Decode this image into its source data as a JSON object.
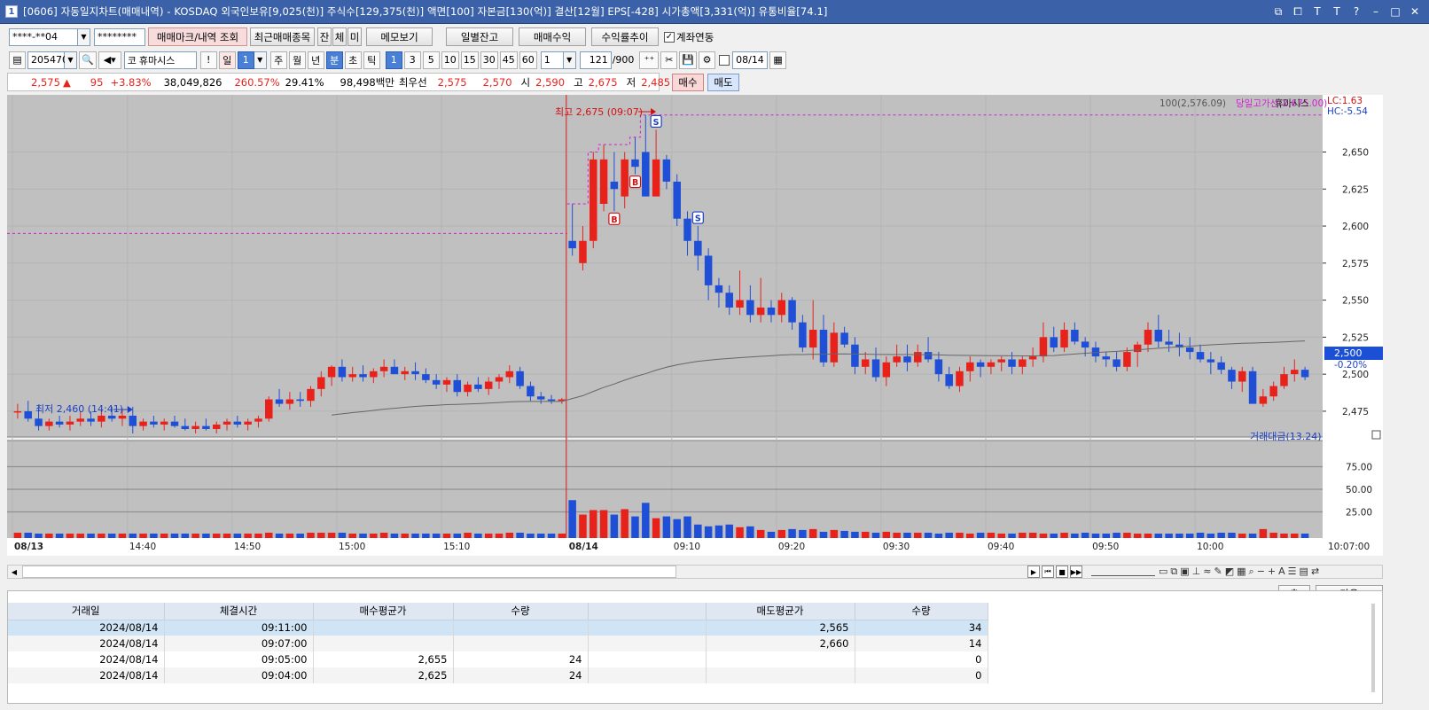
{
  "window": {
    "title": "[0606] 자동일지차트(매매내역) - KOSDAQ 외국인보유[9,025(천)] 주식수[129,375(천)] 액면[100] 자본금[130(억)] 결산[12월] EPS[-428] 시가총액[3,331(억)] 유통비율[74.1]",
    "icon_label": "1",
    "ctrls": [
      "⧉",
      "⧠",
      "T",
      "T",
      "?",
      "–",
      "□",
      "✕"
    ]
  },
  "toolbar1": {
    "account": "****-**04",
    "password": "********",
    "btn_mark": "매매마크/내역 조회",
    "btn_recent": "최근매매종목",
    "btn_jan": "잔",
    "btn_che": "체",
    "btn_mi": "미",
    "btn_memo": "메모보기",
    "btn_daily": "일별잔고",
    "btn_profit": "매매수익",
    "btn_rate": "수익률추이",
    "chk_link": "계좌연동",
    "chk_link_checked": "✓"
  },
  "toolbar2": {
    "code": "205470",
    "market": "코",
    "name": "휴마시스",
    "btn_warn": "!",
    "periods": [
      "일",
      "1",
      "주",
      "월",
      "년",
      "분",
      "초",
      "틱"
    ],
    "intervals": [
      "1",
      "3",
      "5",
      "10",
      "15",
      "30",
      "45",
      "60"
    ],
    "unit": "1",
    "count": "121",
    "count_total": "/900",
    "date": "08/14"
  },
  "pricebar": {
    "price": "2,575",
    "arrow": "▲",
    "change": "95",
    "change_pct": "+3.83%",
    "volume": "38,049,826",
    "vol_ratio": "260.57%",
    "turnover": "29.41%",
    "amount": "98,498백만",
    "best_label": "최우선",
    "ask": "2,575",
    "bid": "2,570",
    "open_label": "시",
    "open": "2,590",
    "high_label": "고",
    "high": "2,675",
    "low_label": "저",
    "low": "2,485",
    "buy_btn": "매수",
    "sell_btn": "매도"
  },
  "chart_labels": {
    "ma_label": "100(2,576.09)",
    "highline_label": "당일고가선(2,675.00)",
    "stock_label": "휴마시스",
    "lc": "LC:1.63",
    "hc": "HC:-5.54",
    "high_note": "최고 2,675 (09:07)",
    "low_note": "최저 2,460 (14:41)",
    "cur_price": "2,500",
    "cur_pct": "-0.20%",
    "vol_title": "거래대금(13.24)"
  },
  "chart_data": {
    "type": "candlestick",
    "y_ticks": [
      "2,650",
      "2,625",
      "2,600",
      "2,575",
      "2,550",
      "2,525",
      "2,500",
      "2,475"
    ],
    "ylim": [
      2460,
      2685
    ],
    "vol_ticks": [
      "75.00",
      "50.00",
      "25.00"
    ],
    "vol_lim": [
      0,
      100
    ],
    "x_labels": [
      "08/13",
      "14:40",
      "14:50",
      "15:00",
      "15:10",
      "08/14",
      "09:10",
      "09:20",
      "09:30",
      "09:40",
      "09:50",
      "10:00",
      "10:07:00"
    ],
    "x_label_idx": [
      0,
      11,
      21,
      31,
      41,
      53,
      63,
      73,
      83,
      93,
      103,
      113
    ],
    "session_split_idx": 53,
    "high_mark_idx": 61,
    "low_mark_idx": 11,
    "prev_high": 2595,
    "day_high": 2675,
    "candles": [
      [
        2475,
        2480,
        2470,
        2475
      ],
      [
        2475,
        2482,
        2468,
        2470
      ],
      [
        2470,
        2478,
        2462,
        2465
      ],
      [
        2465,
        2470,
        2462,
        2468
      ],
      [
        2468,
        2472,
        2464,
        2466
      ],
      [
        2466,
        2472,
        2462,
        2468
      ],
      [
        2468,
        2475,
        2465,
        2470
      ],
      [
        2470,
        2475,
        2465,
        2468
      ],
      [
        2468,
        2476,
        2464,
        2472
      ],
      [
        2472,
        2478,
        2468,
        2470
      ],
      [
        2470,
        2476,
        2465,
        2472
      ],
      [
        2472,
        2478,
        2460,
        2465
      ],
      [
        2465,
        2470,
        2462,
        2468
      ],
      [
        2468,
        2472,
        2464,
        2466
      ],
      [
        2466,
        2470,
        2462,
        2468
      ],
      [
        2468,
        2472,
        2464,
        2465
      ],
      [
        2465,
        2470,
        2462,
        2463
      ],
      [
        2463,
        2468,
        2460,
        2465
      ],
      [
        2465,
        2470,
        2462,
        2463
      ],
      [
        2463,
        2468,
        2460,
        2466
      ],
      [
        2466,
        2470,
        2462,
        2468
      ],
      [
        2468,
        2472,
        2464,
        2466
      ],
      [
        2466,
        2470,
        2462,
        2468
      ],
      [
        2468,
        2472,
        2464,
        2470
      ],
      [
        2470,
        2485,
        2468,
        2483
      ],
      [
        2483,
        2490,
        2478,
        2480
      ],
      [
        2480,
        2488,
        2476,
        2483
      ],
      [
        2483,
        2488,
        2478,
        2482
      ],
      [
        2482,
        2492,
        2478,
        2490
      ],
      [
        2490,
        2502,
        2485,
        2498
      ],
      [
        2498,
        2506,
        2492,
        2505
      ],
      [
        2505,
        2510,
        2495,
        2498
      ],
      [
        2498,
        2505,
        2495,
        2500
      ],
      [
        2500,
        2506,
        2495,
        2498
      ],
      [
        2498,
        2504,
        2494,
        2502
      ],
      [
        2502,
        2510,
        2498,
        2505
      ],
      [
        2505,
        2510,
        2500,
        2500
      ],
      [
        2500,
        2505,
        2496,
        2502
      ],
      [
        2502,
        2508,
        2496,
        2500
      ],
      [
        2500,
        2504,
        2494,
        2496
      ],
      [
        2496,
        2500,
        2490,
        2493
      ],
      [
        2493,
        2498,
        2488,
        2496
      ],
      [
        2496,
        2500,
        2485,
        2488
      ],
      [
        2488,
        2495,
        2485,
        2493
      ],
      [
        2493,
        2498,
        2488,
        2490
      ],
      [
        2490,
        2498,
        2486,
        2495
      ],
      [
        2495,
        2500,
        2490,
        2498
      ],
      [
        2498,
        2506,
        2494,
        2502
      ],
      [
        2502,
        2505,
        2490,
        2492
      ],
      [
        2492,
        2495,
        2482,
        2485
      ],
      [
        2485,
        2488,
        2480,
        2483
      ],
      [
        2483,
        2486,
        2480,
        2482
      ],
      [
        2482,
        2484,
        2480,
        2483
      ],
      [
        2590,
        2615,
        2580,
        2585
      ],
      [
        2575,
        2600,
        2570,
        2590
      ],
      [
        2590,
        2650,
        2585,
        2645
      ],
      [
        2615,
        2655,
        2610,
        2645
      ],
      [
        2630,
        2650,
        2610,
        2625
      ],
      [
        2620,
        2650,
        2612,
        2645
      ],
      [
        2645,
        2660,
        2635,
        2640
      ],
      [
        2650,
        2675,
        2620,
        2620
      ],
      [
        2620,
        2665,
        2620,
        2645
      ],
      [
        2645,
        2648,
        2625,
        2630
      ],
      [
        2630,
        2635,
        2600,
        2605
      ],
      [
        2605,
        2610,
        2580,
        2590
      ],
      [
        2590,
        2600,
        2570,
        2580
      ],
      [
        2580,
        2585,
        2550,
        2560
      ],
      [
        2560,
        2565,
        2545,
        2555
      ],
      [
        2555,
        2560,
        2540,
        2545
      ],
      [
        2545,
        2570,
        2540,
        2550
      ],
      [
        2550,
        2560,
        2535,
        2540
      ],
      [
        2540,
        2565,
        2535,
        2545
      ],
      [
        2545,
        2550,
        2535,
        2540
      ],
      [
        2540,
        2555,
        2535,
        2550
      ],
      [
        2550,
        2552,
        2530,
        2535
      ],
      [
        2535,
        2540,
        2515,
        2518
      ],
      [
        2518,
        2550,
        2510,
        2530
      ],
      [
        2530,
        2540,
        2505,
        2508
      ],
      [
        2508,
        2535,
        2505,
        2528
      ],
      [
        2528,
        2532,
        2518,
        2520
      ],
      [
        2520,
        2525,
        2500,
        2505
      ],
      [
        2505,
        2515,
        2500,
        2510
      ],
      [
        2510,
        2518,
        2495,
        2498
      ],
      [
        2498,
        2512,
        2492,
        2508
      ],
      [
        2508,
        2520,
        2505,
        2512
      ],
      [
        2512,
        2520,
        2502,
        2508
      ],
      [
        2508,
        2520,
        2505,
        2515
      ],
      [
        2515,
        2525,
        2508,
        2510
      ],
      [
        2510,
        2515,
        2495,
        2500
      ],
      [
        2500,
        2505,
        2490,
        2492
      ],
      [
        2492,
        2505,
        2488,
        2502
      ],
      [
        2502,
        2512,
        2495,
        2508
      ],
      [
        2508,
        2510,
        2498,
        2505
      ],
      [
        2505,
        2510,
        2500,
        2508
      ],
      [
        2508,
        2512,
        2502,
        2510
      ],
      [
        2510,
        2515,
        2500,
        2505
      ],
      [
        2505,
        2512,
        2500,
        2510
      ],
      [
        2510,
        2518,
        2505,
        2512
      ],
      [
        2512,
        2535,
        2508,
        2525
      ],
      [
        2525,
        2532,
        2515,
        2518
      ],
      [
        2518,
        2535,
        2515,
        2530
      ],
      [
        2530,
        2535,
        2520,
        2522
      ],
      [
        2522,
        2525,
        2512,
        2518
      ],
      [
        2518,
        2522,
        2508,
        2512
      ],
      [
        2512,
        2515,
        2505,
        2510
      ],
      [
        2510,
        2515,
        2502,
        2505
      ],
      [
        2505,
        2518,
        2502,
        2515
      ],
      [
        2515,
        2522,
        2505,
        2520
      ],
      [
        2520,
        2535,
        2515,
        2530
      ],
      [
        2530,
        2540,
        2518,
        2522
      ],
      [
        2522,
        2530,
        2515,
        2520
      ],
      [
        2520,
        2528,
        2512,
        2518
      ],
      [
        2518,
        2525,
        2510,
        2515
      ],
      [
        2515,
        2520,
        2508,
        2510
      ],
      [
        2510,
        2515,
        2500,
        2508
      ],
      [
        2508,
        2512,
        2500,
        2503
      ],
      [
        2503,
        2505,
        2490,
        2495
      ],
      [
        2495,
        2505,
        2488,
        2502
      ],
      [
        2502,
        2505,
        2480,
        2480
      ],
      [
        2480,
        2490,
        2478,
        2485
      ],
      [
        2485,
        2495,
        2482,
        2492
      ],
      [
        2492,
        2505,
        2490,
        2500
      ],
      [
        2500,
        2510,
        2495,
        2503
      ],
      [
        2503,
        2505,
        2496,
        2498
      ]
    ],
    "volumes": [
      2,
      2,
      1,
      1,
      1,
      1,
      1,
      1,
      1,
      1,
      1,
      1,
      1,
      1,
      1,
      1,
      1,
      1,
      1,
      1,
      1,
      1,
      1,
      1,
      2,
      1,
      1,
      1,
      2,
      2,
      2,
      2,
      1,
      1,
      1,
      2,
      1,
      1,
      1,
      1,
      1,
      1,
      1,
      2,
      1,
      1,
      1,
      2,
      2,
      1,
      1,
      1,
      1,
      38,
      22,
      27,
      27,
      22,
      28,
      20,
      35,
      18,
      20,
      17,
      20,
      11,
      9,
      10,
      11,
      8,
      9,
      5,
      3,
      5,
      6,
      5,
      6,
      3,
      5,
      4,
      3,
      3,
      2,
      3,
      2,
      2,
      2,
      2,
      1,
      2,
      2,
      1,
      2,
      2,
      1,
      1,
      2,
      2,
      1,
      1,
      2,
      1,
      2,
      1,
      1,
      2,
      2,
      1,
      1,
      1,
      1,
      1,
      1,
      2,
      1,
      2,
      2,
      1,
      1,
      6,
      2,
      1,
      1,
      1
    ]
  },
  "markers": [
    {
      "idx": 57,
      "type": "B"
    },
    {
      "idx": 59,
      "type": "B"
    },
    {
      "idx": 61,
      "type": "S"
    },
    {
      "idx": 65,
      "type": "S"
    }
  ],
  "nav": {
    "btns": [
      "▶",
      "⏮",
      "■",
      "▶▶"
    ]
  },
  "grid": {
    "headers": [
      "거래일",
      "체결시간",
      "매수평균가",
      "수량",
      "",
      "매도평균가",
      "수량"
    ],
    "rows": [
      [
        "2024/08/14",
        "09:11:00",
        "",
        "",
        "",
        "2,565",
        "34"
      ],
      [
        "2024/08/14",
        "09:07:00",
        "",
        "",
        "",
        "2,660",
        "14"
      ],
      [
        "2024/08/14",
        "09:05:00",
        "2,655",
        "24",
        "",
        "",
        "0"
      ],
      [
        "2024/08/14",
        "09:04:00",
        "2,625",
        "24",
        "",
        "",
        "0"
      ]
    ],
    "next_btn": "다음",
    "gear_icon": "gear-icon"
  },
  "colors": {
    "up": "#e8211b",
    "down": "#1e4fd6",
    "bg": "#c0c0c0",
    "highline": "#d020d0",
    "ma": "#666666",
    "title": "#3b62a8"
  }
}
